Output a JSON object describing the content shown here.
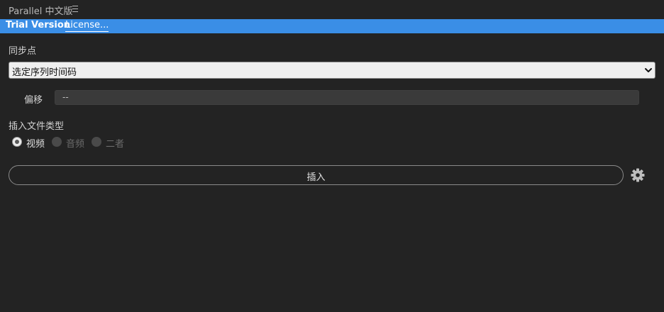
{
  "panel": {
    "title": "Parallel 中文版",
    "menu_icon": "hamburger-menu-icon"
  },
  "license_bar": {
    "trial_label": "Trial Version",
    "license_link": "License...",
    "background_color": "#3a8ee6"
  },
  "sync": {
    "label": "同步点",
    "selected": "选定序列时间码"
  },
  "offset": {
    "label": "偏移",
    "value": "--"
  },
  "insert_type": {
    "label": "插入文件类型",
    "options": [
      {
        "label": "视频",
        "checked": true,
        "enabled": true
      },
      {
        "label": "音频",
        "checked": false,
        "enabled": false
      },
      {
        "label": "二者",
        "checked": false,
        "enabled": false
      }
    ]
  },
  "insert_button": {
    "label": "插入"
  },
  "settings": {
    "icon": "gear-icon"
  }
}
